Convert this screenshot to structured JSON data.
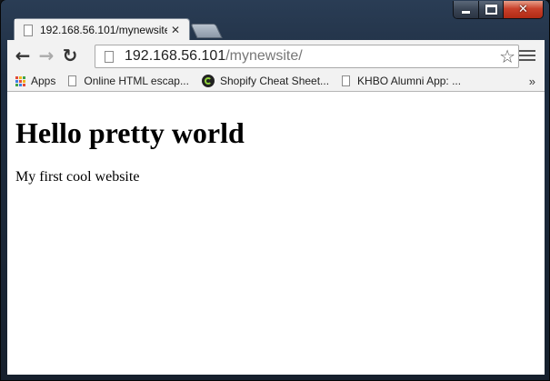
{
  "window": {
    "caption": {
      "minimize": "minimize-icon",
      "maximize": "maximize-icon",
      "close": "close-icon",
      "close_glyph": "✕"
    }
  },
  "tab": {
    "title": "192.168.56.101/mynewsite",
    "close_glyph": "✕"
  },
  "toolbar": {
    "back_glyph": "←",
    "forward_glyph": "→",
    "reload_glyph": "↻",
    "url_host": "192.168.56.101",
    "url_path": "/mynewsite/",
    "star_glyph": "☆"
  },
  "bookmarks": {
    "items": [
      {
        "label": "Apps"
      },
      {
        "label": "Online HTML escap..."
      },
      {
        "label": "Shopify Cheat Sheet..."
      },
      {
        "label": "KHBO Alumni App: ..."
      }
    ],
    "more": "»"
  },
  "page": {
    "heading": "Hello pretty world",
    "paragraph": "My first cool website"
  },
  "colors": {
    "apps_grid": [
      "#e04b3a",
      "#f2b619",
      "#3fa14a",
      "#3d7de6",
      "#e04b3a",
      "#f2b619",
      "#3fa14a",
      "#3d7de6",
      "#e04b3a"
    ]
  }
}
